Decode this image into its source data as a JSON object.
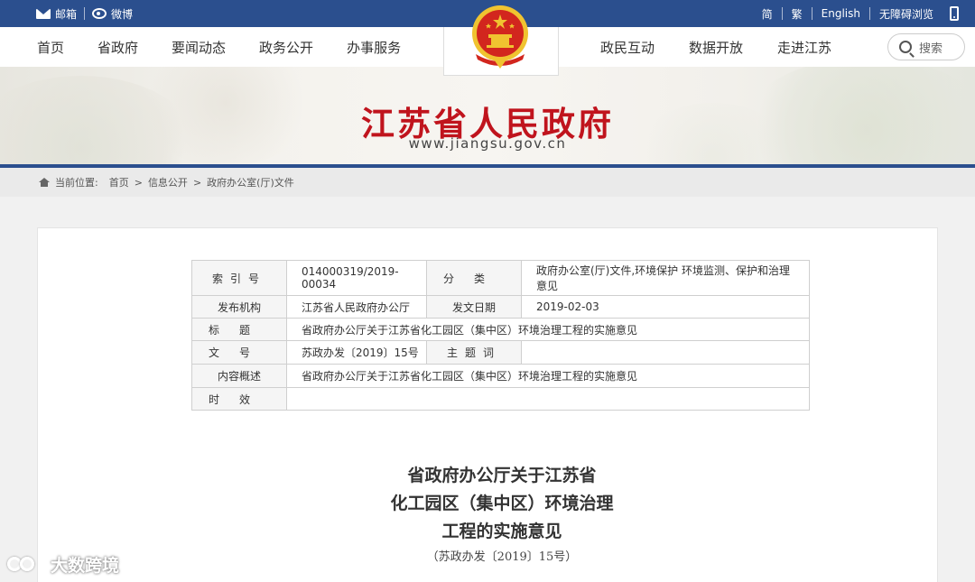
{
  "topbar": {
    "mail_label": "邮箱",
    "weibo_label": "微博",
    "lang_simplified": "简",
    "lang_traditional": "繁",
    "lang_english": "English",
    "accessibility": "无障碍浏览"
  },
  "nav": {
    "left": [
      "首页",
      "省政府",
      "要闻动态",
      "政务公开",
      "办事服务"
    ],
    "right": [
      "政民互动",
      "数据开放",
      "走进江苏"
    ],
    "search_label": "搜索"
  },
  "banner": {
    "title": "江苏省人民政府",
    "url": "www.jiangsu.gov.cn"
  },
  "breadcrumb": {
    "prefix": "当前位置:",
    "items": [
      "首页",
      "信息公开",
      "政府办公室(厅)文件"
    ],
    "separator": ">"
  },
  "meta": {
    "index_label": "索引号",
    "index_value": "014000319/2019-00034",
    "category_label": "分类",
    "category_value": "政府办公室(厅)文件,环境保护 环境监测、保护和治理 意见",
    "publisher_label": "发布机构",
    "publisher_value": "江苏省人民政府办公厅",
    "date_label": "发文日期",
    "date_value": "2019-02-03",
    "title_label": "标题",
    "title_value": "省政府办公厅关于江苏省化工园区（集中区）环境治理工程的实施意见",
    "docno_label": "文号",
    "docno_value": "苏政办发〔2019〕15号",
    "keyword_label": "主题词",
    "keyword_value": "",
    "summary_label": "内容概述",
    "summary_value": "省政府办公厅关于江苏省化工园区（集中区）环境治理工程的实施意见",
    "validity_label": "时效",
    "validity_value": ""
  },
  "document": {
    "title_line1": "省政府办公厅关于江苏省",
    "title_line2": "化工园区（集中区）环境治理",
    "title_line3": "工程的实施意见",
    "number": "（苏政办发〔2019〕15号）"
  },
  "watermark": {
    "text": "大数跨境"
  },
  "colors": {
    "topbar_bg": "#2b4f8e",
    "title_red": "#c0141d",
    "emblem_red": "#d2261e",
    "emblem_gold": "#f0c330"
  }
}
